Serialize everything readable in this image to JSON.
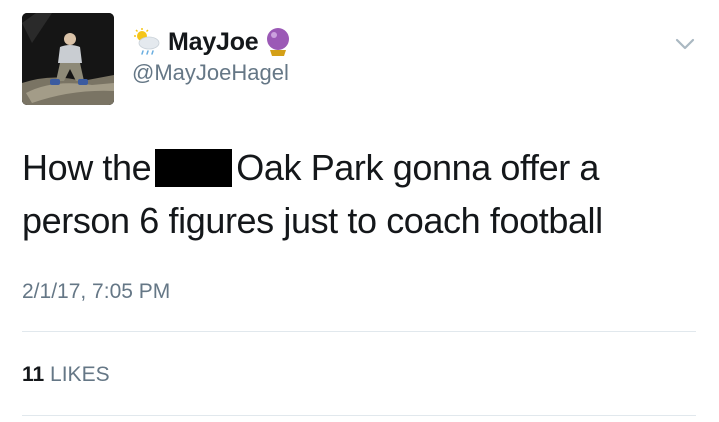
{
  "user": {
    "display_name": "MayJoe",
    "handle": "@MayJoeHagel"
  },
  "icons": {
    "name_emoji_1": "sun-behind-rain-cloud-icon",
    "name_emoji_2": "crystal-ball-icon",
    "menu": "chevron-down-icon"
  },
  "tweet": {
    "text_part1": "How the",
    "text_part2": "Oak Park gonna offer a person 6 figures just to coach football",
    "timestamp": "2/1/17, 7:05 PM"
  },
  "stats": {
    "likes_count": "11",
    "likes_label": "LIKES"
  },
  "colors": {
    "text": "#14171a",
    "secondary": "#657786",
    "divider": "#e1e8ed",
    "crystal": "#9b59b6"
  }
}
